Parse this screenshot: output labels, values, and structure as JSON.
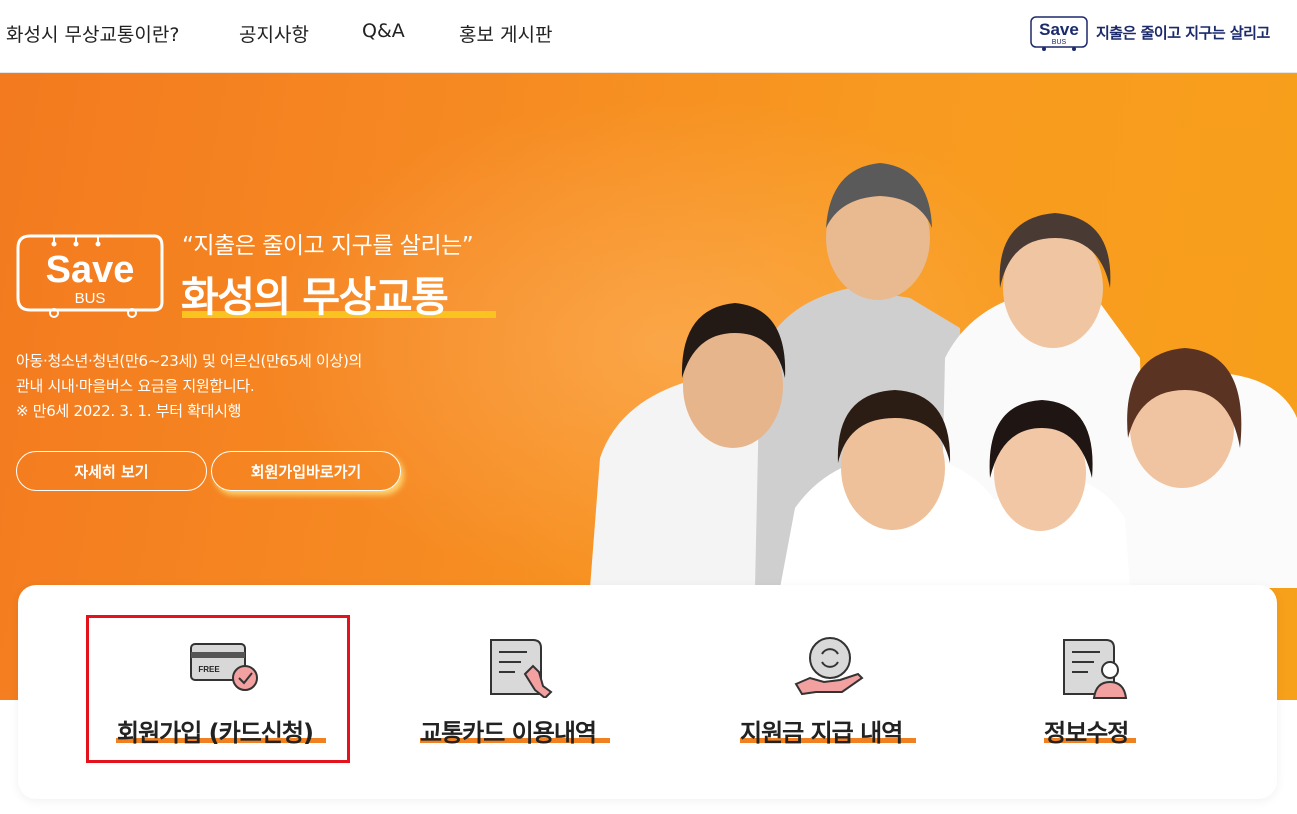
{
  "nav": {
    "items": [
      "화성시 무상교통이란?",
      "공지사항",
      "Q&A",
      "홍보 게시판"
    ],
    "brand_logo_text": "Save",
    "brand_logo_sub": "BUS",
    "brand_slogan": "지출은 줄이고 지구는 살리고"
  },
  "hero": {
    "logo_text": "Save",
    "logo_sub": "BUS",
    "quote": "“지출은 줄이고 지구를 살리는”",
    "title": "화성의 무상교통",
    "desc_lines": [
      "아동·청소년·청년(만6~23세) 및 어르신(만65세 이상)의",
      "관내 시내·마을버스 요금을 지원합니다.",
      "※ 만6세 2022. 3. 1. 부터 확대시행"
    ],
    "buttons": [
      "자세히 보기",
      "회원가입바로가기"
    ]
  },
  "services": [
    {
      "label": "회원가입 (카드신청)",
      "icon": "free-card-icon",
      "icon_text": "FREE"
    },
    {
      "label": "교통카드 이용내역",
      "icon": "document-hand-icon"
    },
    {
      "label": "지원금 지급 내역",
      "icon": "coin-hand-icon"
    },
    {
      "label": "정보수정",
      "icon": "document-user-icon"
    }
  ],
  "colors": {
    "hero_orange": "#f37a1f",
    "accent_yellow": "#f9c320",
    "underline_orange": "#f08020",
    "highlight_red": "#e3121d",
    "brand_navy": "#1b2a6b"
  }
}
